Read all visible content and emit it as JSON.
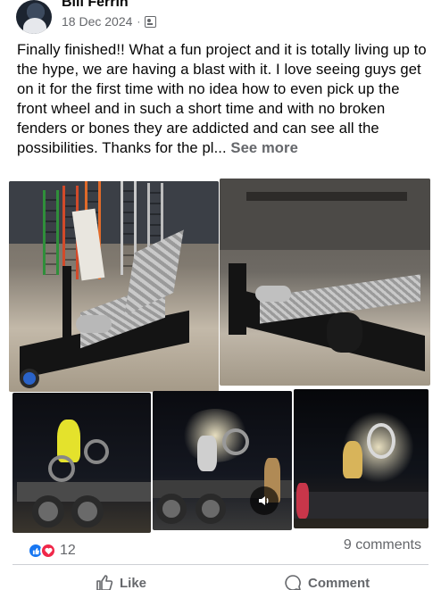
{
  "post": {
    "author": "Bill Ferrin",
    "date": "18 Dec 2024",
    "separator": "·",
    "audience_icon": "friends-icon",
    "text": "Finally finished!!  What a fun project and it is totally living up to the hype, we are having a blast with it. I love seeing guys get on it for the first time with no idea how to even pick up the front wheel and in such a short time and with no broken fenders or bones they are addicted and can see all the possibilities. Thanks for the pl...",
    "see_more": "See more"
  },
  "photos": [
    {
      "subject": "wheelie-machine-workshop"
    },
    {
      "subject": "wheelie-machine-side"
    },
    {
      "subject": "rider-yellow-night"
    },
    {
      "subject": "rider-night-trailer"
    },
    {
      "subject": "rider-night-spotlight"
    }
  ],
  "stats": {
    "reaction_count": "12",
    "comments": "9 comments",
    "reaction_colors": {
      "like": "#1877f2",
      "love": "#f0284a"
    }
  },
  "actions": {
    "like": "Like",
    "comment": "Comment"
  }
}
